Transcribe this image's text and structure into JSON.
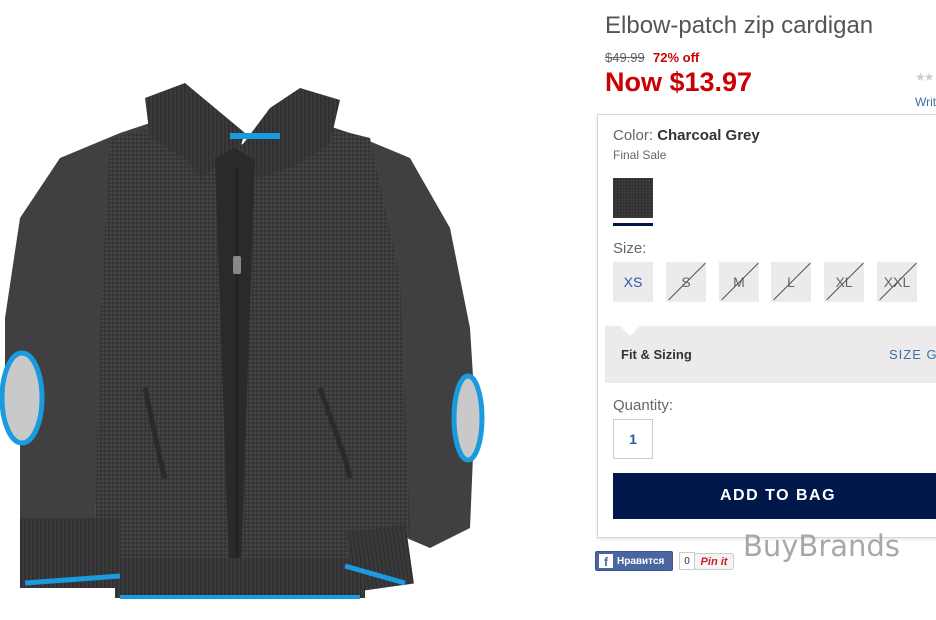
{
  "product": {
    "title": "Elbow-patch zip cardigan",
    "old_price": "$49.99",
    "discount": "72% off",
    "now_price": "Now $13.97",
    "rating_stars": "★★",
    "write_review": "Writ"
  },
  "color": {
    "label": "Color:",
    "value": "Charcoal Grey",
    "final_sale": "Final Sale",
    "swatch_color": "#3c3c3e"
  },
  "size": {
    "label": "Size:",
    "options": [
      {
        "label": "XS",
        "available": true
      },
      {
        "label": "S",
        "available": false
      },
      {
        "label": "M",
        "available": false
      },
      {
        "label": "L",
        "available": false
      },
      {
        "label": "XL",
        "available": false
      },
      {
        "label": "XXL",
        "available": false
      }
    ]
  },
  "fit": {
    "label": "Fit & Sizing",
    "size_guide": "SIZE G"
  },
  "quantity": {
    "label": "Quantity:",
    "value": "1"
  },
  "cta": {
    "add_to_bag": "ADD TO BAG",
    "color": "#00174a"
  },
  "social": {
    "fb_like": "Нравится",
    "fb_count": "0",
    "pin_it": "Pin it"
  },
  "watermark": "BuyBrands",
  "colors": {
    "sale_red": "#cc0000",
    "link_blue": "#3b6fa6",
    "sweater_body": "#3a3a3c",
    "trim_blue": "#1a9be0",
    "patch_grey": "#c9c9c9"
  }
}
